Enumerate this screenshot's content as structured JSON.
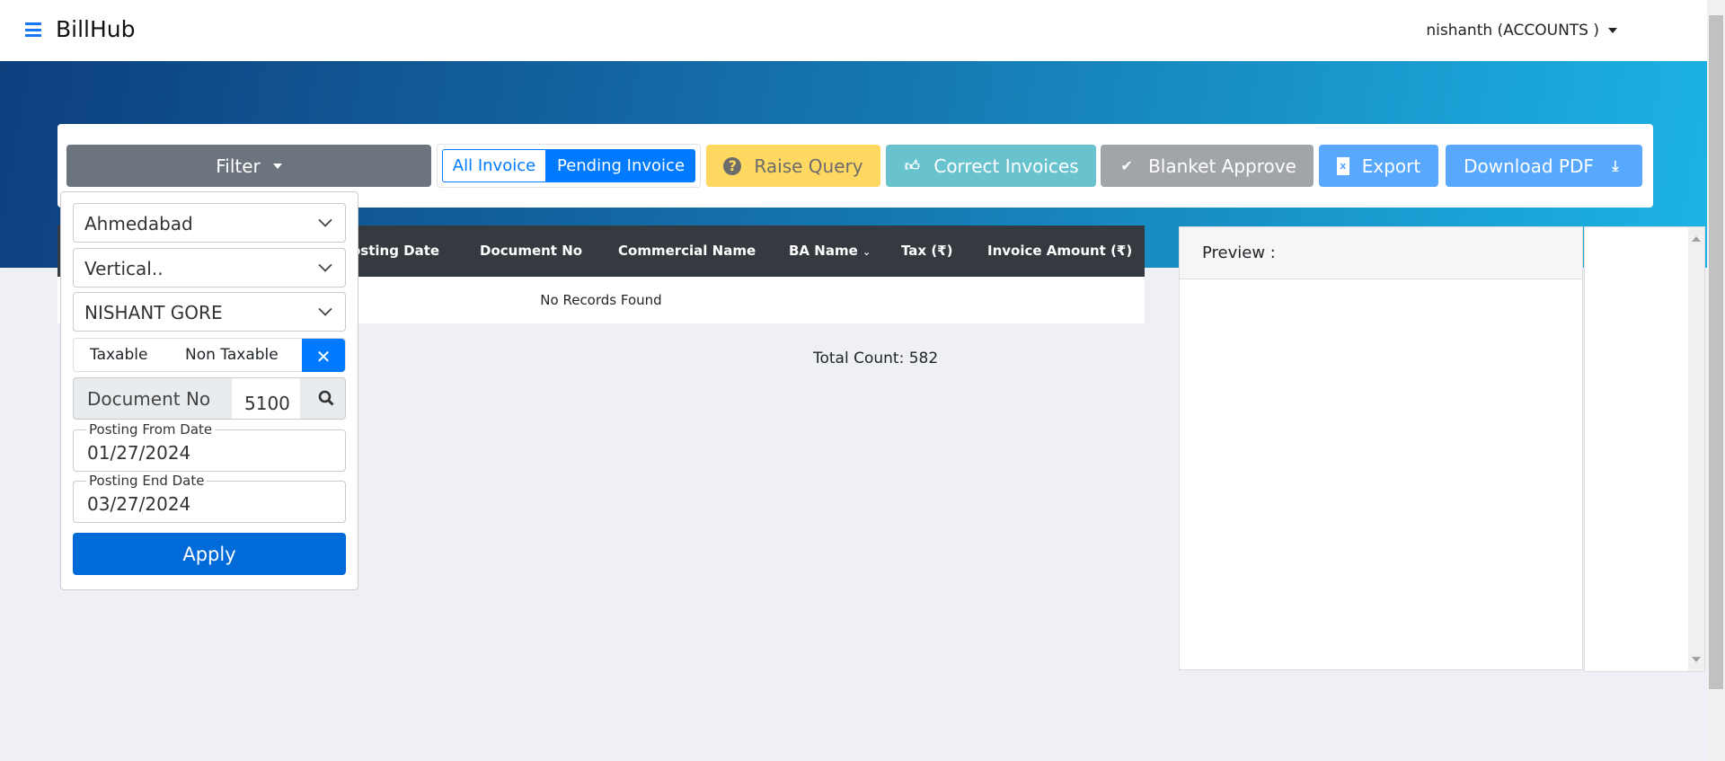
{
  "header": {
    "brand": "BillHub",
    "user": "nishanth (ACCOUNTS )"
  },
  "toolbar": {
    "filter": "Filter",
    "all_invoice": "All Invoice",
    "pending_invoice": "Pending Invoice",
    "raise_query": "Raise Query",
    "correct_invoices": "Correct Invoices",
    "blanket_approve": "Blanket Approve",
    "export": "Export",
    "download_pdf": "Download PDF"
  },
  "filter": {
    "location": "Ahmedabad",
    "vertical": "Vertical..",
    "person": "NISHANT GORE",
    "taxable": "Taxable",
    "non_taxable": "Non Taxable",
    "document_label": "Document No",
    "document_value": "5100",
    "from_label": "Posting From Date",
    "from_value": "01/27/2024",
    "end_label": "Posting End Date",
    "end_value": "03/27/2024",
    "apply": "Apply"
  },
  "table": {
    "columns": [
      "Posting Date",
      "Document No",
      "Commercial Name",
      "BA Name",
      "Tax (₹)",
      "Invoice Amount (₹)"
    ],
    "empty": "No Records Found"
  },
  "total_count": "Total Count: 582",
  "preview": {
    "title": "Preview :"
  },
  "colors": {
    "primary": "#007bff",
    "warning": "#ffd862",
    "info": "#68c3cf",
    "secondary": "#6c757d"
  }
}
